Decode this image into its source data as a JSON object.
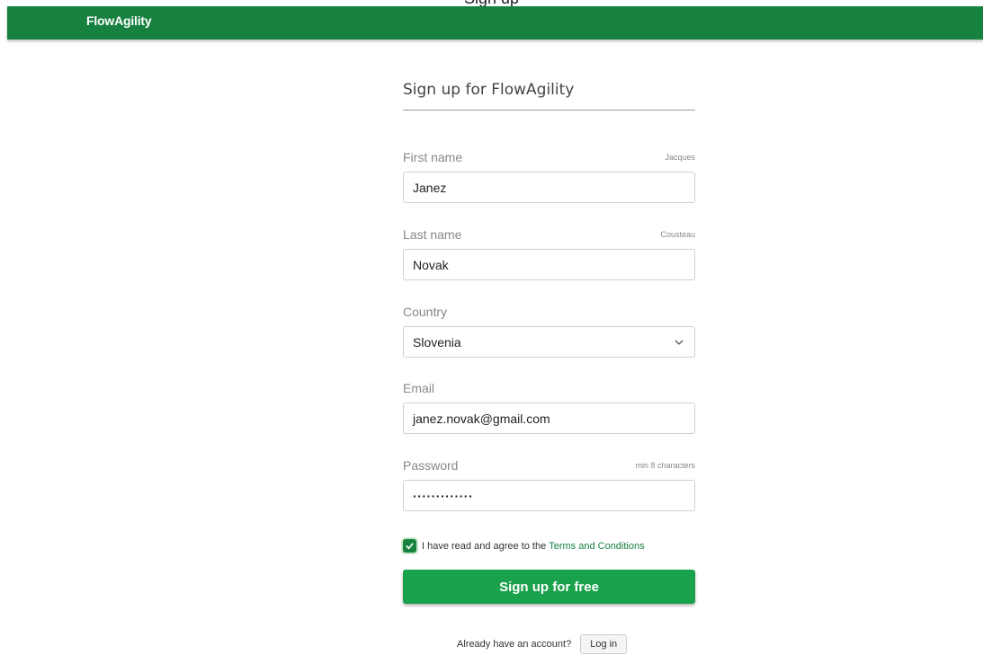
{
  "browser_caption": "Sign up",
  "header": {
    "brand": "FlowAgility"
  },
  "form": {
    "title": "Sign up for FlowAgility",
    "first_name": {
      "label": "First name",
      "hint": "Jacques",
      "value": "Janez"
    },
    "last_name": {
      "label": "Last name",
      "hint": "Cousteau",
      "value": "Novak"
    },
    "country": {
      "label": "Country",
      "value": "Slovenia"
    },
    "email": {
      "label": "Email",
      "value": "janez.novak@gmail.com"
    },
    "password": {
      "label": "Password",
      "hint": "min 8 characters",
      "value": "·············"
    },
    "agree_text": "I have read and agree to the",
    "terms_link": "Terms and Conditions",
    "agree_checked": true,
    "submit_label": "Sign up for free",
    "have_account_text": "Already have an account?",
    "login_label": "Log in"
  },
  "colors": {
    "brand_green": "#178140",
    "button_green": "#1aa14b"
  }
}
